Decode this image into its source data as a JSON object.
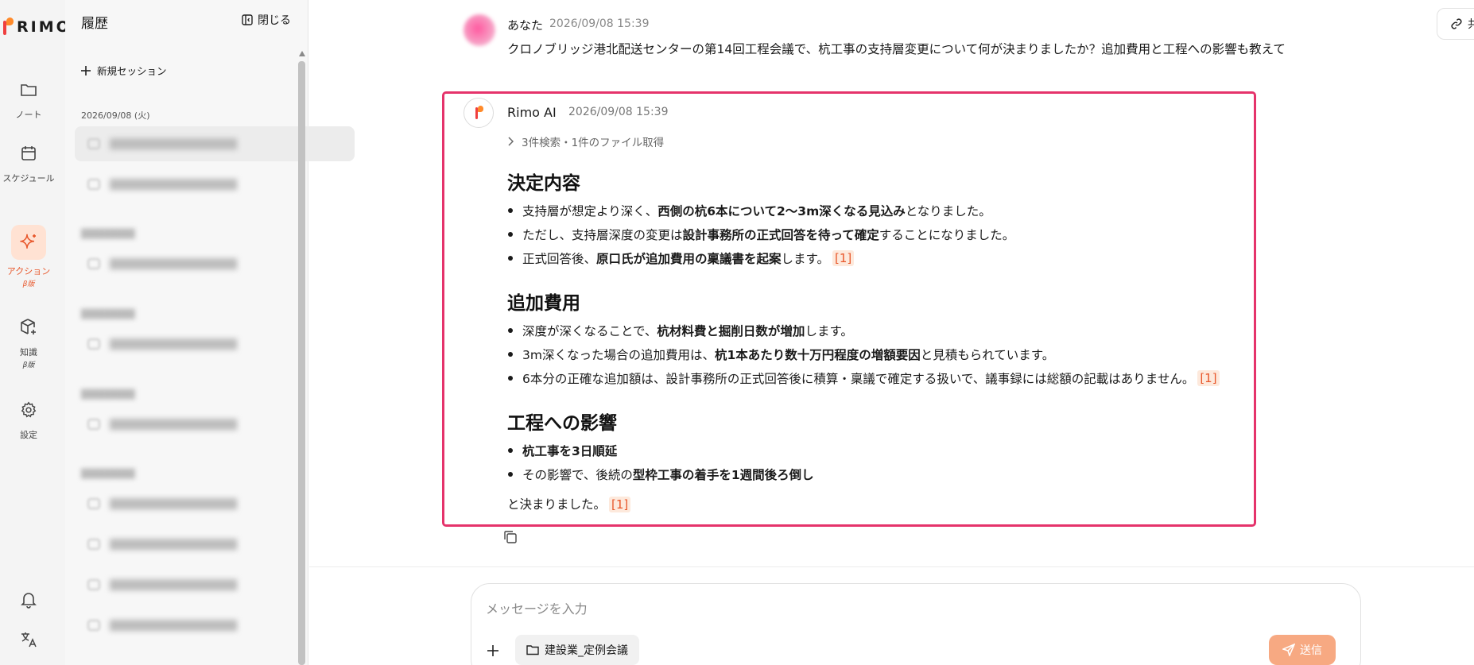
{
  "app": {
    "logo_text": "RIMO",
    "accent_color": "#e8572b",
    "highlight_color": "#e5336b"
  },
  "rail": {
    "items": [
      {
        "id": "note",
        "label": "ノート",
        "icon": "folder-icon"
      },
      {
        "id": "schedule",
        "label": "スケジュール",
        "icon": "calendar-icon"
      },
      {
        "id": "action",
        "label": "アクション",
        "sub": "β版",
        "icon": "sparkle-icon",
        "active": true
      },
      {
        "id": "knowledge",
        "label": "知識",
        "sub": "β版",
        "icon": "cube-plus-icon"
      },
      {
        "id": "settings",
        "label": "設定",
        "icon": "gear-icon"
      }
    ],
    "bottom_icons": [
      "bell-icon",
      "translate-icon"
    ]
  },
  "history": {
    "title": "履歴",
    "close_label": "閉じる",
    "new_session_label": "新規セッション",
    "first_date": "2026/09/08 (火)"
  },
  "conversation": {
    "user": {
      "name": "あなた",
      "time": "2026/09/08 15:39",
      "message": "クロノブリッジ港北配送センターの第14回工程会議で、杭工事の支持層変更について何が決まりましたか？追加費用と工程への影響も教えて"
    },
    "ai": {
      "name": "Rimo AI",
      "time": "2026/09/08 15:39",
      "search_summary": "3件検索・1件のファイル取得",
      "sections": [
        {
          "heading": "決定内容",
          "bullets": [
            {
              "pre": "支持層が想定より深く、",
              "bold": "西側の杭6本について2〜3m深くなる見込み",
              "post": "となりました。",
              "cite": ""
            },
            {
              "pre": "ただし、支持層深度の変更は",
              "bold": "設計事務所の正式回答を待って確定",
              "post": "することになりました。",
              "cite": ""
            },
            {
              "pre": "正式回答後、",
              "bold": "原口氏が追加費用の稟議書を起案",
              "post": "します。",
              "cite": "[1]"
            }
          ]
        },
        {
          "heading": "追加費用",
          "bullets": [
            {
              "pre": "深度が深くなることで、",
              "bold": "杭材料費と掘削日数が増加",
              "post": "します。",
              "cite": ""
            },
            {
              "pre": "3m深くなった場合の追加費用は、",
              "bold": "杭1本あたり数十万円程度の増額要因",
              "post": "と見積もられています。",
              "cite": ""
            },
            {
              "pre": "6本分の正確な追加額は、設計事務所の正式回答後に積算・稟議で確定する扱いで、議事録には総額の記載はありません。",
              "bold": "",
              "post": "",
              "cite": "[1]"
            }
          ]
        },
        {
          "heading": "工程への影響",
          "bullets": [
            {
              "pre": "",
              "bold": "杭工事を3日順延",
              "post": "",
              "cite": ""
            },
            {
              "pre": "その影響で、後続の",
              "bold": "型枠工事の着手を1週間後ろ倒し",
              "post": "",
              "cite": ""
            }
          ]
        }
      ],
      "closing": "と決まりました。",
      "closing_cite": "[1]"
    }
  },
  "composer": {
    "placeholder": "メッセージを入力",
    "folder_label": "建設業_定例会議",
    "send_label": "送信"
  }
}
